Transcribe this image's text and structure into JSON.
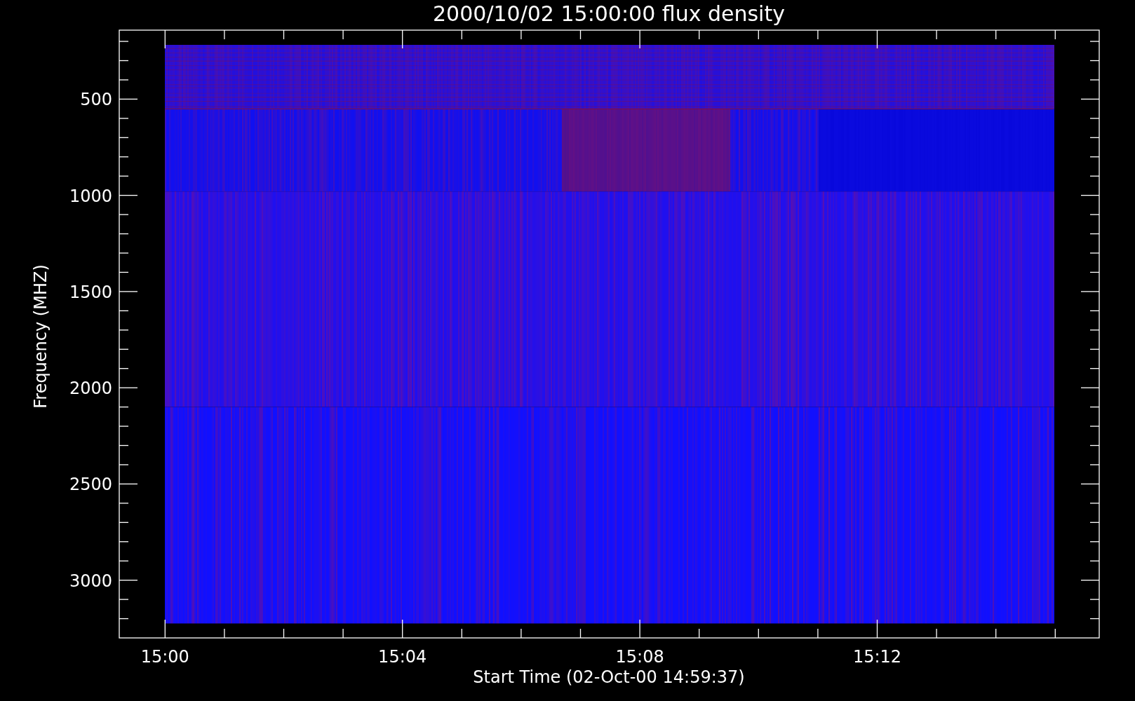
{
  "title": "2000/10/02 15:00:00 flux density",
  "y_axis": {
    "label": "Frequency (MHZ)",
    "ticks": [
      "500",
      "1000",
      "1500",
      "2000",
      "2500",
      "3000"
    ]
  },
  "x_axis": {
    "label": "Start Time (02-Oct-00 14:59:37)",
    "ticks": [
      "15:00",
      "15:04",
      "15:08",
      "15:12"
    ]
  }
}
